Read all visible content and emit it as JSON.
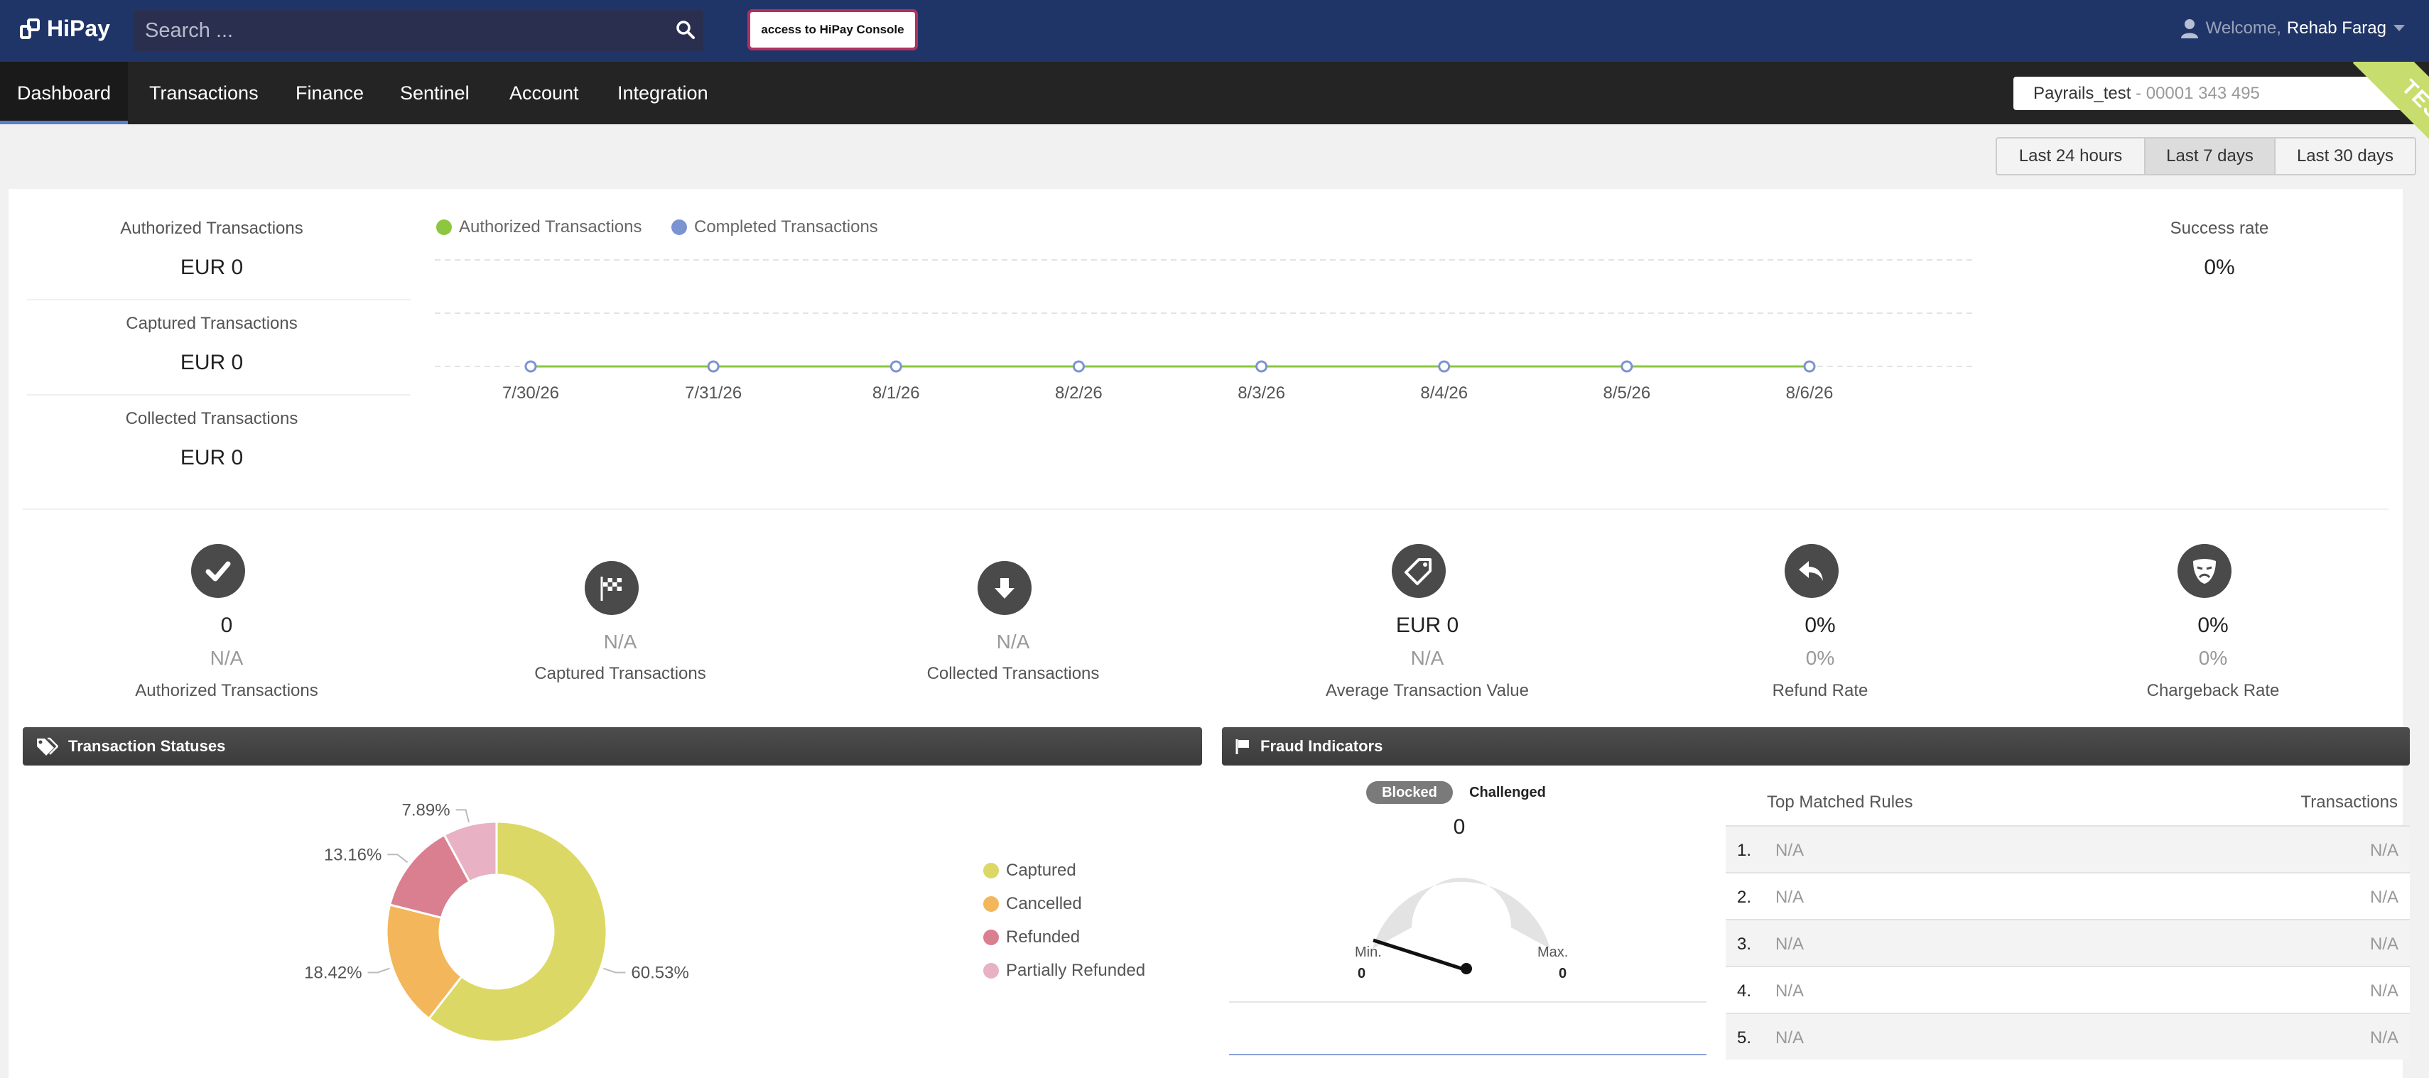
{
  "header": {
    "logo_text": "HiPay",
    "search_placeholder": "Search ...",
    "console_button": "access to HiPay Console",
    "welcome_prefix": "Welcome,",
    "user_name": "Rehab Farag"
  },
  "nav": {
    "items": [
      "Dashboard",
      "Transactions",
      "Finance",
      "Sentinel",
      "Account",
      "Integration"
    ],
    "active": "Dashboard",
    "account_name": "Payrails_test",
    "account_separator": "-",
    "account_id": "00001 343 495",
    "ribbon": "TEST"
  },
  "ranges": [
    "Last 24 hours",
    "Last 7 days",
    "Last 30 days"
  ],
  "active_range": "Last 7 days",
  "summary": {
    "authorized_label": "Authorized Transactions",
    "authorized_value": "EUR 0",
    "captured_label": "Captured Transactions",
    "captured_value": "EUR 0",
    "collected_label": "Collected Transactions",
    "collected_value": "EUR 0",
    "success_label": "Success rate",
    "success_value": "0%"
  },
  "chart_data": [
    {
      "type": "line",
      "x": [
        "7/30/26",
        "7/31/26",
        "8/1/26",
        "8/2/26",
        "8/3/26",
        "8/4/26",
        "8/5/26",
        "8/6/26"
      ],
      "series": [
        {
          "name": "Authorized Transactions",
          "values": [
            0,
            0,
            0,
            0,
            0,
            0,
            0,
            0
          ],
          "color": "#8dc63f"
        },
        {
          "name": "Completed Transactions",
          "values": [
            0,
            0,
            0,
            0,
            0,
            0,
            0,
            0
          ],
          "color": "#7b93d1"
        }
      ],
      "grid": true,
      "legend": "top-left"
    },
    {
      "type": "pie",
      "categories": [
        "Captured",
        "Cancelled",
        "Refunded",
        "Partially Refunded"
      ],
      "values": [
        60.53,
        18.42,
        13.16,
        7.89
      ],
      "labels": [
        "60.53%",
        "18.42%",
        "13.16%",
        "7.89%"
      ],
      "colors": [
        "#dcd866",
        "#f4b65a",
        "#da7f8f",
        "#e9b1c4"
      ],
      "legend": "right"
    }
  ],
  "kpis": [
    {
      "icon": "check-icon",
      "value": "0",
      "sub": "N/A",
      "label": "Authorized Transactions"
    },
    {
      "icon": "checkered-flag-icon",
      "value": "",
      "sub": "N/A",
      "label": "Captured Transactions"
    },
    {
      "icon": "download-arrow-icon",
      "value": "",
      "sub": "N/A",
      "label": "Collected Transactions"
    },
    {
      "icon": "price-tag-icon",
      "value": "EUR 0",
      "sub": "N/A",
      "label": "Average Transaction Value"
    },
    {
      "icon": "reply-arrow-icon",
      "value": "0%",
      "sub": "0%",
      "label": "Refund Rate"
    },
    {
      "icon": "sad-mask-icon",
      "value": "0%",
      "sub": "0%",
      "label": "Chargeback Rate"
    }
  ],
  "statuses_panel": {
    "title": "Transaction Statuses"
  },
  "fraud_panel": {
    "title": "Fraud Indicators",
    "tab_blocked": "Blocked",
    "tab_challenged": "Challenged",
    "gauge_value": "0",
    "min_label": "Min.",
    "min_value": "0",
    "max_label": "Max.",
    "max_value": "0",
    "rules_header": "Top Matched Rules",
    "count_header": "Transactions",
    "rules": [
      {
        "idx": "1.",
        "name": "N/A",
        "count": "N/A"
      },
      {
        "idx": "2.",
        "name": "N/A",
        "count": "N/A"
      },
      {
        "idx": "3.",
        "name": "N/A",
        "count": "N/A"
      },
      {
        "idx": "4.",
        "name": "N/A",
        "count": "N/A"
      },
      {
        "idx": "5.",
        "name": "N/A",
        "count": "N/A"
      }
    ]
  }
}
